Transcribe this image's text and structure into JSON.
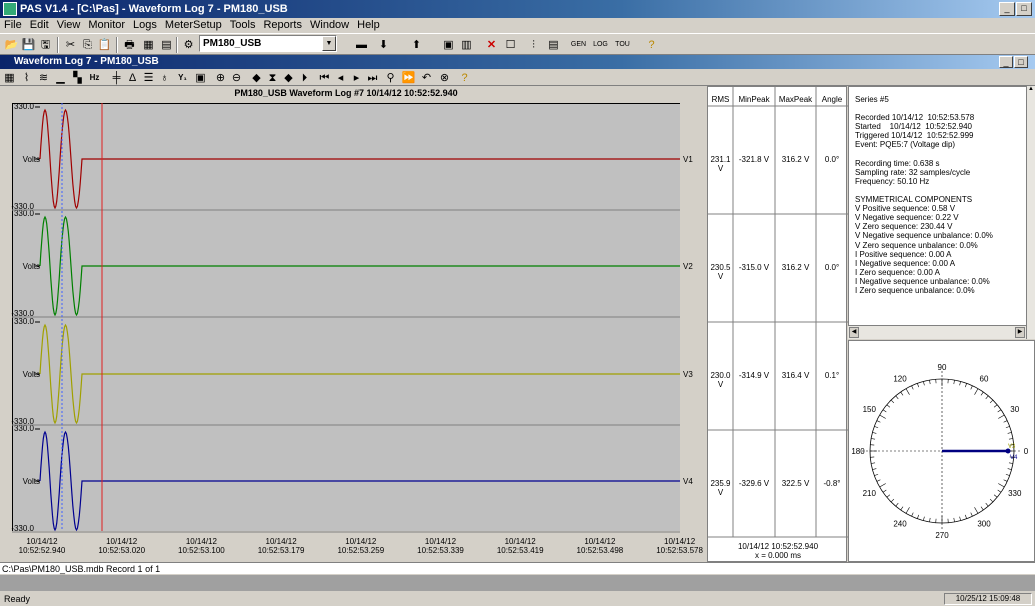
{
  "app": {
    "title": "PAS V1.4 - [C:\\Pas] - Waveform Log 7 - PM180_USB"
  },
  "menu": [
    "File",
    "Edit",
    "View",
    "Monitor",
    "Logs",
    "MeterSetup",
    "Tools",
    "Reports",
    "Window",
    "Help"
  ],
  "toolbar": {
    "device": "PM180_USB"
  },
  "child": {
    "title": "Waveform Log 7 - PM180_USB"
  },
  "plot": {
    "title": "PM180_USB  Waveform Log #7  10/14/12  10:52:52.940",
    "ymax": "330.0",
    "ymin": "-330.0",
    "unit": "Volts",
    "x_labels": [
      [
        "10/14/12",
        "10:52:52.940"
      ],
      [
        "10/14/12",
        "10:52:53.020"
      ],
      [
        "10/14/12",
        "10:52:53.100"
      ],
      [
        "10/14/12",
        "10:52:53.179"
      ],
      [
        "10/14/12",
        "10:52:53.259"
      ],
      [
        "10/14/12",
        "10:52:53.339"
      ],
      [
        "10/14/12",
        "10:52:53.419"
      ],
      [
        "10/14/12",
        "10:52:53.498"
      ],
      [
        "10/14/12",
        "10:52:53.578"
      ]
    ]
  },
  "chart_data": {
    "type": "line",
    "title": "PM180_USB  Waveform Log #7  10/14/12  10:52:52.940",
    "ylabel": "Volts",
    "ylim": [
      -330.0,
      330.0
    ],
    "series": [
      {
        "name": "V1",
        "color": "#a00000"
      },
      {
        "name": "V2",
        "color": "#008000"
      },
      {
        "name": "V3",
        "color": "#a0a000"
      },
      {
        "name": "V4",
        "color": "#000090"
      }
    ]
  },
  "table": {
    "headers": [
      "RMS",
      "MinPeak",
      "MaxPeak",
      "Angle"
    ],
    "rows": [
      [
        "231.1 V",
        "-321.8 V",
        "316.2 V",
        "0.0°"
      ],
      [
        "230.5 V",
        "-315.0 V",
        "316.2 V",
        "0.0°"
      ],
      [
        "230.0 V",
        "-314.9 V",
        "316.4 V",
        "0.1°"
      ],
      [
        "235.9 V",
        "-329.6 V",
        "322.5 V",
        "-0.8°"
      ]
    ],
    "cursor_time": "10/14/12  10:52:52.940",
    "cursor_x": "x = 0.000 ms"
  },
  "info": {
    "lines": [
      "Series #5",
      "",
      "Recorded 10/14/12  10:52:53.578",
      "Started    10/14/12  10:52:52.940",
      "Triggered 10/14/12  10:52:52.999",
      "Event: PQE5:7 (Voltage dip)",
      "",
      "Recording time: 0.638 s",
      "Sampling rate: 32 samples/cycle",
      "Frequency: 50.10 Hz",
      "",
      "SYMMETRICAL COMPONENTS",
      "V Positive sequence: 0.58 V",
      "V Negative sequence: 0.22 V",
      "V Zero sequence: 230.44 V",
      "V Negative sequence unbalance: 0.0%",
      "V Zero sequence unbalance: 0.0%",
      "I Positive sequence: 0.00 A",
      "I Negative sequence: 0.00 A",
      "I Zero sequence: 0.00 A",
      "I Negative sequence unbalance: 0.0%",
      "I Zero sequence unbalance: 0.0%"
    ]
  },
  "phasor": {
    "angles": [
      "90",
      "60",
      "30",
      "0",
      "330",
      "300",
      "270",
      "240",
      "210",
      "180",
      "150",
      "120"
    ],
    "labels": [
      "V3",
      "V4"
    ]
  },
  "path": {
    "text": "C:\\Pas\\PM180_USB.mdb  Record 1 of 1"
  },
  "status": {
    "ready": "Ready",
    "clock": "10/25/12 15:09:48"
  }
}
